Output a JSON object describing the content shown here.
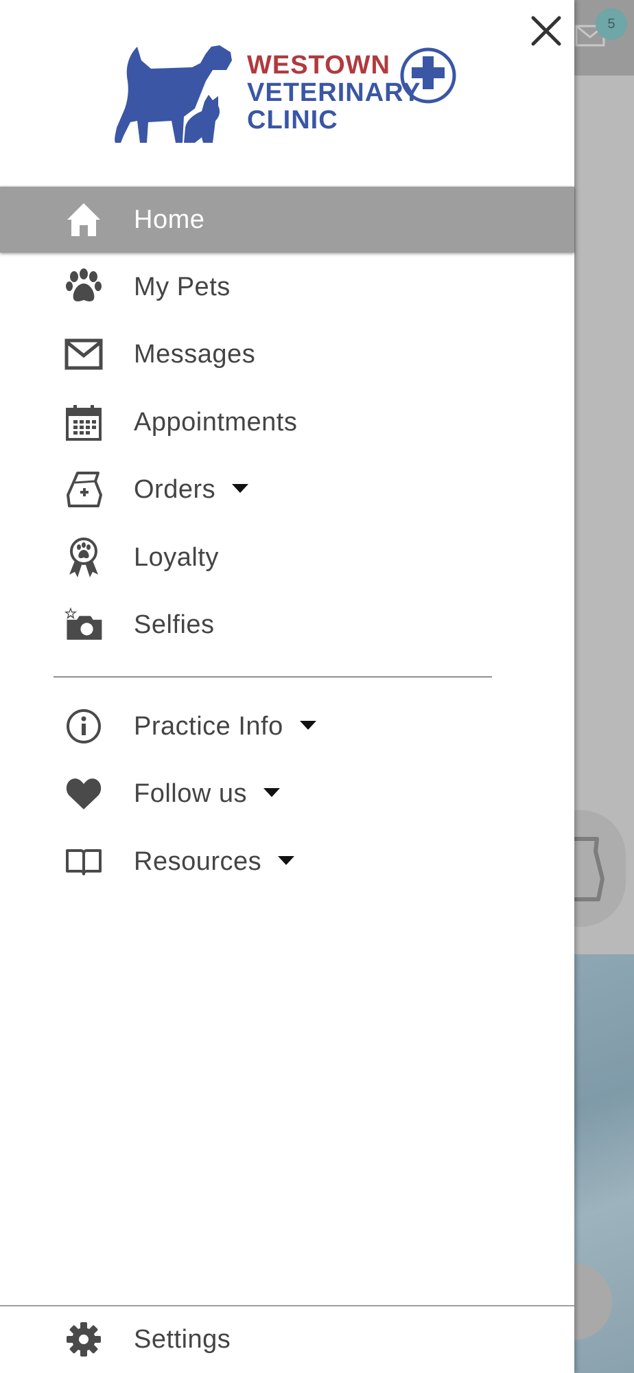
{
  "background": {
    "notification_count": "5"
  },
  "drawer": {
    "logo": {
      "line1": "WESTOWN",
      "line2": "VETERINARY",
      "line3": "CLINIC"
    },
    "menu": [
      {
        "label": "Home",
        "icon": "home-icon",
        "active": true
      },
      {
        "label": "My Pets",
        "icon": "paw-icon"
      },
      {
        "label": "Messages",
        "icon": "envelope-icon"
      },
      {
        "label": "Appointments",
        "icon": "calendar-icon"
      },
      {
        "label": "Orders",
        "icon": "food-bag-icon",
        "expandable": true
      },
      {
        "label": "Loyalty",
        "icon": "award-ribbon-icon"
      },
      {
        "label": "Selfies",
        "icon": "camera-icon"
      }
    ],
    "secondary_menu": [
      {
        "label": "Practice Info",
        "icon": "info-icon",
        "expandable": true
      },
      {
        "label": "Follow us",
        "icon": "heart-icon",
        "expandable": true
      },
      {
        "label": "Resources",
        "icon": "book-icon",
        "expandable": true
      }
    ],
    "settings": {
      "label": "Settings",
      "icon": "gear-icon"
    }
  },
  "colors": {
    "logo_red": "#b03a3e",
    "logo_blue": "#3a56a5",
    "active_bg": "#9e9e9e",
    "icon_gray": "#4a4a4a",
    "text_gray": "#444444"
  }
}
